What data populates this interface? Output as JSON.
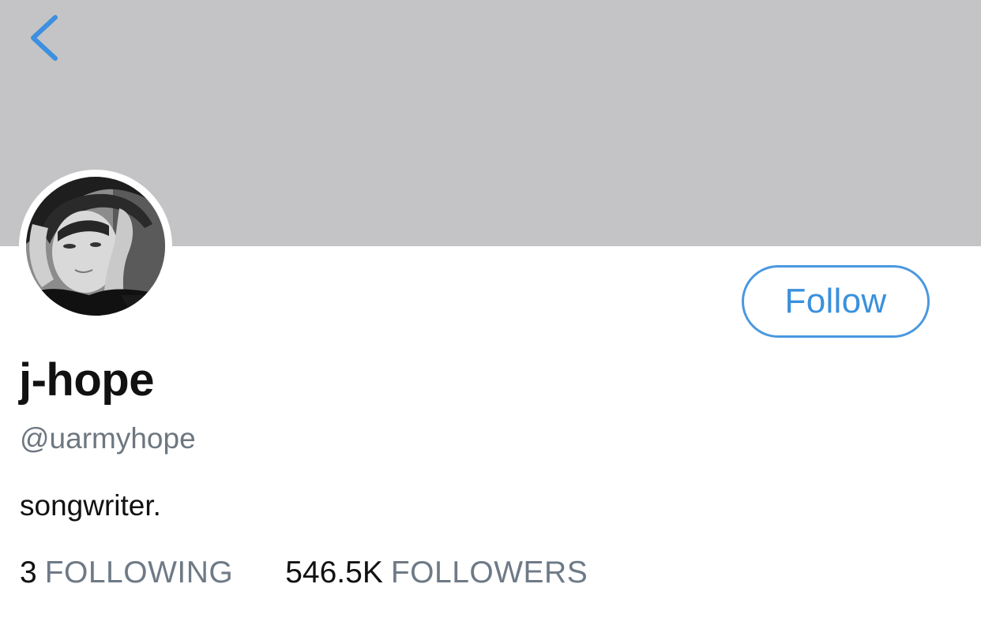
{
  "header": {
    "banner_color": "#c4c4c6",
    "back_icon": "chevron-left-icon",
    "accent_color": "#4a98e0"
  },
  "profile": {
    "display_name": "j-hope",
    "handle": "@uarmyhope",
    "bio": "songwriter.",
    "avatar": "profile-photo (black-and-white)"
  },
  "actions": {
    "follow_label": "Follow"
  },
  "stats": {
    "following_count": "3",
    "following_label": "FOLLOWING",
    "followers_count": "546.5K",
    "followers_label": "FOLLOWERS"
  }
}
